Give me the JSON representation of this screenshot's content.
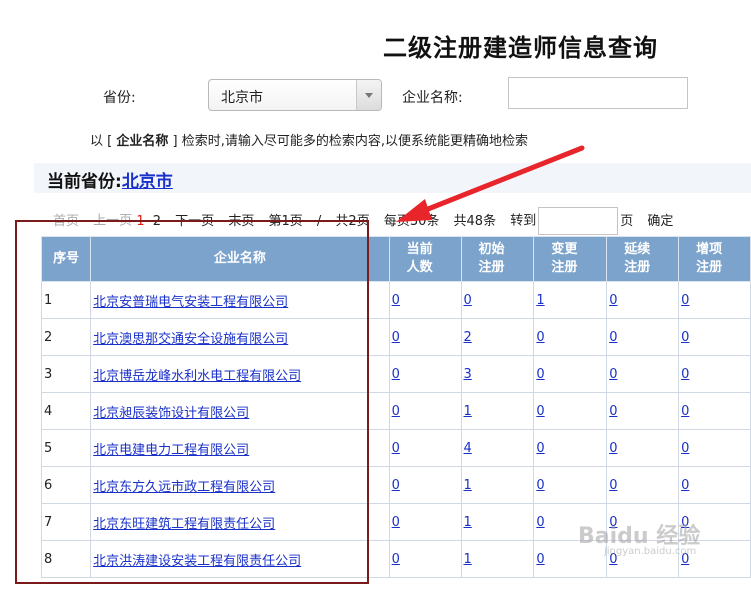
{
  "page_title": "二级注册建造师信息查询",
  "filters": {
    "province_label": "省份:",
    "province_value": "北京市",
    "company_label": "企业名称:",
    "company_value": ""
  },
  "hint": {
    "prefix": "以  [ ",
    "keyword": "企业名称",
    "suffix": " ] 检索时,请输入尽可能多的检索内容,以便系统能更精确地检索"
  },
  "current_province": {
    "label": "当前省份:",
    "value": "北京市"
  },
  "pager": {
    "first": "首页",
    "prev": "上一页",
    "page1": "1",
    "page2": "2",
    "next": "下一页",
    "last": "末页",
    "current": "第1页",
    "sep": "/",
    "total_pages": "共2页",
    "per_page": "每页30条",
    "total_items": "共48条",
    "goto_label": "转到",
    "goto_value": "",
    "page_unit": "页",
    "confirm": "确定"
  },
  "table": {
    "headers": [
      "序号",
      "企业名称",
      "当前\n人数",
      "初始\n注册",
      "变更\n注册",
      "延续\n注册",
      "增项\n注册"
    ],
    "rows": [
      {
        "no": "1",
        "name": "北京安普瑞电气安装工程有限公司",
        "c1": "0",
        "c2": "0",
        "c3": "1",
        "c4": "0",
        "c5": "0"
      },
      {
        "no": "2",
        "name": "北京澳思那交通安全设施有限公司",
        "c1": "0",
        "c2": "2",
        "c3": "0",
        "c4": "0",
        "c5": "0"
      },
      {
        "no": "3",
        "name": "北京博岳龙峰水利水电工程有限公司",
        "c1": "0",
        "c2": "3",
        "c3": "0",
        "c4": "0",
        "c5": "0"
      },
      {
        "no": "4",
        "name": "北京昶辰装饰设计有限公司",
        "c1": "0",
        "c2": "1",
        "c3": "0",
        "c4": "0",
        "c5": "0"
      },
      {
        "no": "5",
        "name": "北京电建电力工程有限公司",
        "c1": "0",
        "c2": "4",
        "c3": "0",
        "c4": "0",
        "c5": "0"
      },
      {
        "no": "6",
        "name": "北京东方久远市政工程有限公司",
        "c1": "0",
        "c2": "1",
        "c3": "0",
        "c4": "0",
        "c5": "0"
      },
      {
        "no": "7",
        "name": "北京东旺建筑工程有限责任公司",
        "c1": "0",
        "c2": "1",
        "c3": "0",
        "c4": "0",
        "c5": "0"
      },
      {
        "no": "8",
        "name": "北京洪涛建设安装工程有限责任公司",
        "c1": "0",
        "c2": "1",
        "c3": "0",
        "c4": "0",
        "c5": "0"
      }
    ]
  },
  "watermark": {
    "main": "Baidu 经验",
    "sub": "jingyan.baidu.com"
  },
  "colors": {
    "header_bg": "#7ba3cc",
    "link": "#1a31c9",
    "annotation": "#7b1a1a",
    "arrow": "#e8252a"
  }
}
